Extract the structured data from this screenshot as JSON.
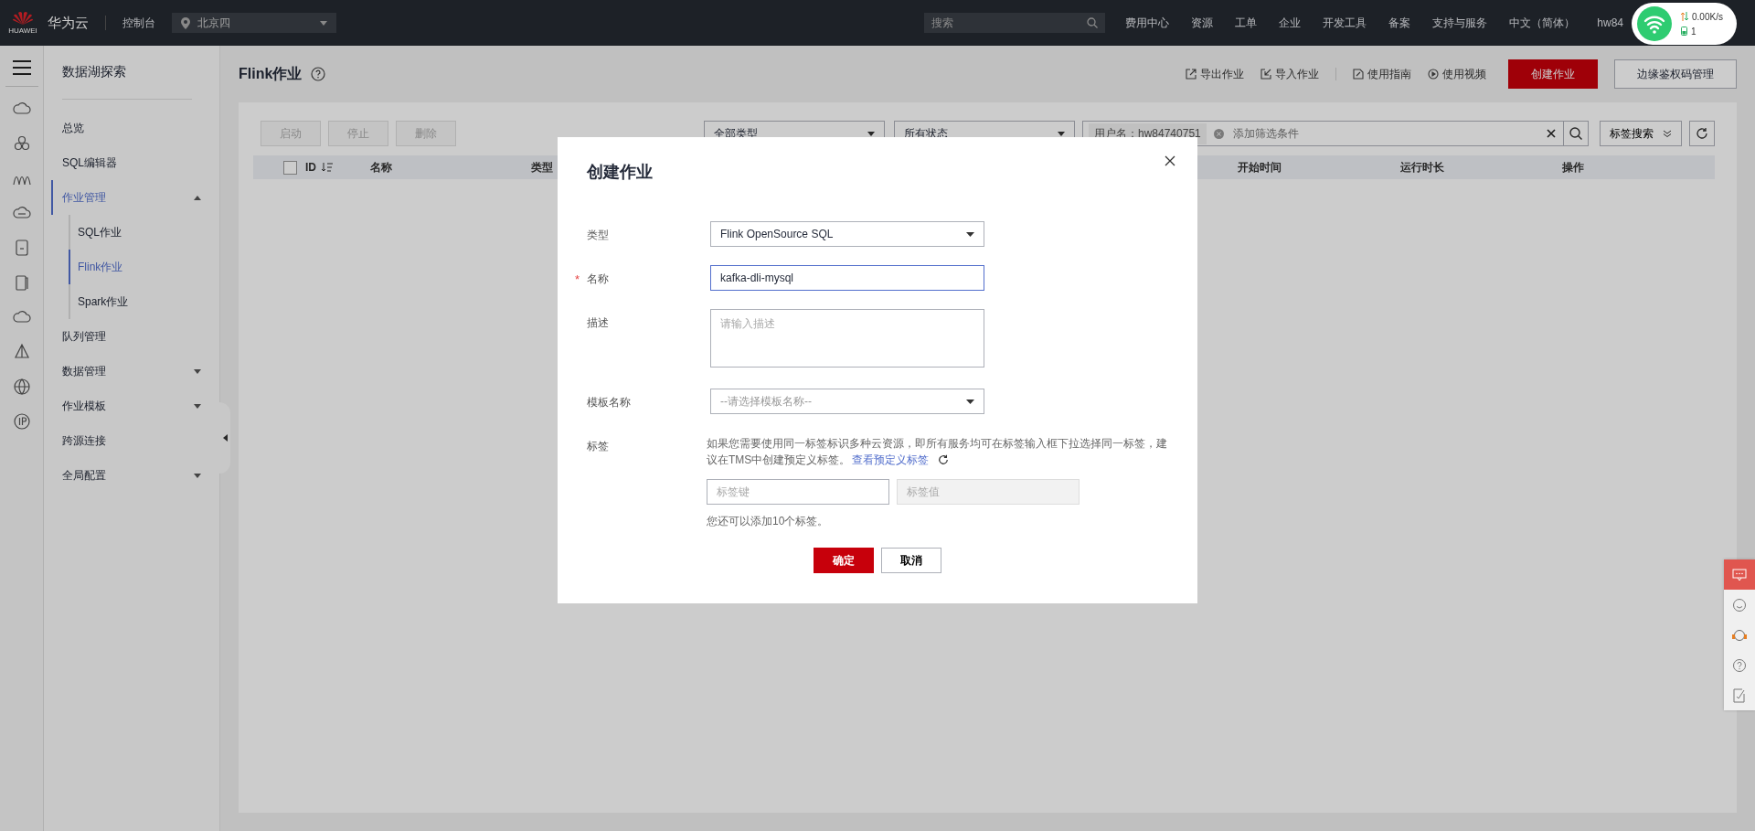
{
  "topbar": {
    "logo_text": "HUAWEI",
    "brand": "华为云",
    "console": "控制台",
    "region": "北京四",
    "search": {
      "placeholder": "搜索"
    },
    "nav": [
      "费用中心",
      "资源",
      "工单",
      "企业",
      "开发工具",
      "备案",
      "支持与服务",
      "中文（简体）"
    ],
    "user": "hw84",
    "network": {
      "speed": "0.00K/s",
      "count": "1"
    }
  },
  "sidebar": {
    "title": "数据湖探索",
    "items": [
      {
        "label": "总览",
        "selected": false
      },
      {
        "label": "SQL编辑器",
        "selected": false
      },
      {
        "label": "作业管理",
        "selected": true,
        "expanded": true,
        "children": [
          {
            "label": "SQL作业",
            "selected": false
          },
          {
            "label": "Flink作业",
            "selected": true
          },
          {
            "label": "Spark作业",
            "selected": false
          }
        ]
      },
      {
        "label": "队列管理",
        "selected": false
      },
      {
        "label": "数据管理",
        "selected": false,
        "expanded": false
      },
      {
        "label": "作业模板",
        "selected": false,
        "expanded": false
      },
      {
        "label": "跨源连接",
        "selected": false
      },
      {
        "label": "全局配置",
        "selected": false,
        "expanded": false
      }
    ]
  },
  "page": {
    "title": "Flink作业",
    "links": [
      {
        "kind": "export",
        "label": "导出作业"
      },
      {
        "kind": "import",
        "label": "导入作业"
      },
      {
        "kind": "guide",
        "label": "使用指南"
      },
      {
        "kind": "video",
        "label": "使用视频"
      }
    ],
    "buttons": [
      {
        "label": "创建作业",
        "primary": true
      },
      {
        "label": "边缘鉴权码管理",
        "primary": false
      }
    ]
  },
  "toolbar": {
    "buttons": [
      {
        "label": "启动",
        "disabled": true
      },
      {
        "label": "停止",
        "disabled": true
      },
      {
        "label": "删除",
        "disabled": true
      }
    ],
    "filters": [
      "全部类型",
      "所有状态"
    ],
    "chip": "用户名：hw84740751",
    "search": {
      "placeholder": "添加筛选条件"
    },
    "tag_search": "标签搜索"
  },
  "table": {
    "select_all": {
      "checked": false
    },
    "columns": [
      "ID",
      "名称",
      "类型",
      "开始时间",
      "运行时长",
      "操作"
    ]
  },
  "dialog": {
    "title": "创建作业",
    "fields": [
      {
        "kind": "select",
        "label": "类型",
        "value": "Flink OpenSource SQL"
      },
      {
        "kind": "input",
        "marker": "*",
        "label": "名称",
        "value": "kafka-dli-mysql"
      },
      {
        "kind": "textarea",
        "label": "描述",
        "placeholder": "请输入描述"
      },
      {
        "kind": "select",
        "label": "模板名称",
        "placeholder": "--请选择模板名称--"
      },
      {
        "kind": "tags",
        "label": "标签",
        "hint": "如果您需要使用同一标签标识多种云资源，即所有服务均可在标签输入框下拉选择同一标签，建议在TMS中创建预定义标签。",
        "link": "查看预定义标签",
        "key_placeholder": "标签键",
        "value_placeholder": "标签值",
        "note": "您还可以添加10个标签。"
      }
    ],
    "buttons": [
      {
        "label": "确定",
        "primary": true
      },
      {
        "label": "取消",
        "primary": false
      }
    ]
  }
}
